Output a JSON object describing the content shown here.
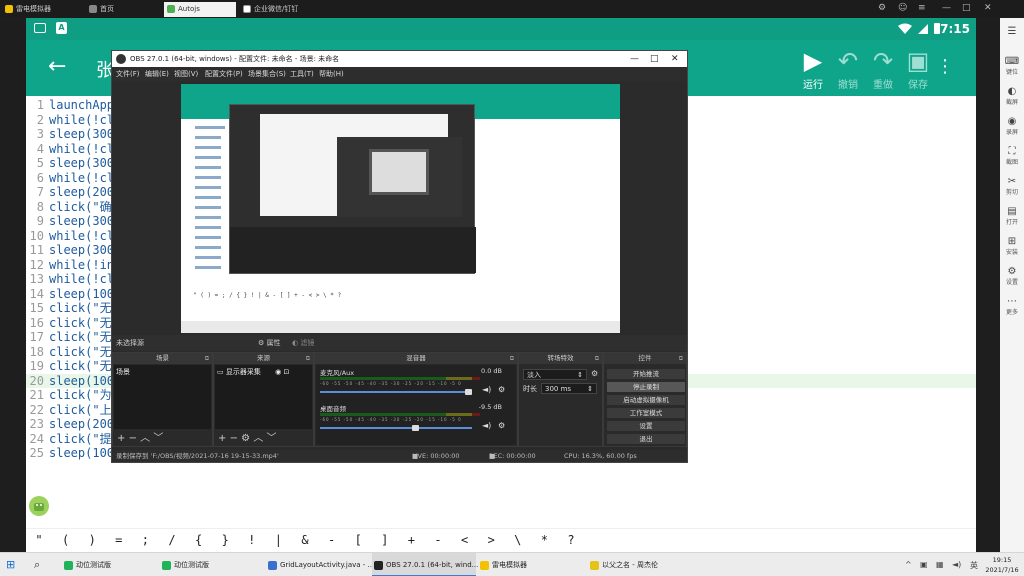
{
  "emulator": {
    "tabs": [
      {
        "label": "雷电模拟器",
        "active": false
      },
      {
        "label": "首页",
        "active": false
      },
      {
        "label": "Autojs",
        "active": true
      },
      {
        "label": "企业微信/钉钉",
        "active": false
      }
    ]
  },
  "statusbar": {
    "time": "7:15",
    "app_badge": "A"
  },
  "appbar": {
    "title": "张",
    "actions": [
      {
        "label": "运行",
        "icon": "play-icon",
        "glyph": "▶"
      },
      {
        "label": "撤销",
        "icon": "undo-icon",
        "glyph": "↶"
      },
      {
        "label": "重做",
        "icon": "redo-icon",
        "glyph": "↷"
      },
      {
        "label": "保存",
        "icon": "save-icon",
        "glyph": "▣"
      }
    ]
  },
  "code": {
    "highlight_line": 20,
    "lines": [
      {
        "n": "1",
        "t": "launchApp"
      },
      {
        "n": "2",
        "t": "while(!cl"
      },
      {
        "n": "3",
        "t": "sleep(300"
      },
      {
        "n": "4",
        "t": "while(!cl"
      },
      {
        "n": "5",
        "t": "sleep(300"
      },
      {
        "n": "6",
        "t": "while(!cl"
      },
      {
        "n": "7",
        "t": "sleep(200"
      },
      {
        "n": "8",
        "t": "click(\"确"
      },
      {
        "n": "9",
        "t": "sleep(300"
      },
      {
        "n": "10",
        "t": "while(!cl"
      },
      {
        "n": "11",
        "t": "sleep(300"
      },
      {
        "n": "12",
        "t": "while(!in"
      },
      {
        "n": "13",
        "t": "while(!cl"
      },
      {
        "n": "14",
        "t": "sleep(100"
      },
      {
        "n": "15",
        "t": "click(\"无"
      },
      {
        "n": "16",
        "t": "click(\"无"
      },
      {
        "n": "17",
        "t": "click(\"无"
      },
      {
        "n": "18",
        "t": "click(\"无"
      },
      {
        "n": "19",
        "t": "click(\"无"
      },
      {
        "n": "20",
        "t": "sleep(100"
      },
      {
        "n": "21",
        "t": "click(\"为"
      },
      {
        "n": "22",
        "t": "click(\"上"
      },
      {
        "n": "23",
        "t": "sleep(200"
      },
      {
        "n": "24",
        "t": "click(\"提"
      },
      {
        "n": "25",
        "t": "sleep(100"
      }
    ]
  },
  "symbols": [
    "\"",
    "(",
    ")",
    "=",
    ";",
    "/",
    "{",
    "}",
    "!",
    "|",
    "&",
    "-",
    "[",
    "]",
    "+",
    "-",
    "<",
    ">",
    "\\",
    "*",
    "?"
  ],
  "right_sidebar": [
    {
      "label": "",
      "glyph": "☰"
    },
    {
      "label": "键位",
      "glyph": "⌨"
    },
    {
      "label": "截屏",
      "glyph": "◐"
    },
    {
      "label": "录屏",
      "glyph": "◉"
    },
    {
      "label": "截图",
      "glyph": "⛶"
    },
    {
      "label": "剪切",
      "glyph": "✂"
    },
    {
      "label": "打开",
      "glyph": "▤"
    },
    {
      "label": "安装",
      "glyph": "⊞"
    },
    {
      "label": "设置",
      "glyph": "⚙"
    },
    {
      "label": "更多",
      "glyph": "⋯"
    }
  ],
  "obs": {
    "title": "OBS 27.0.1 (64-bit, windows) - 配置文件: 未命名 - 场景: 未命名",
    "menu": [
      "文件(F)",
      "编辑(E)",
      "视图(V)",
      "配置文件(P)",
      "场景集合(S)",
      "工具(T)",
      "帮助(H)"
    ],
    "no_source": "未选择源",
    "properties": "属性",
    "filters": "滤镜",
    "docks": {
      "scenes": {
        "title": "场景",
        "items": [
          "场景"
        ]
      },
      "sources": {
        "title": "来源",
        "items": [
          "显示器采集"
        ]
      },
      "mixer": {
        "title": "混音器",
        "channels": [
          {
            "name": "麦克风/Aux",
            "db": "0.0 dB",
            "fader": 0.98
          },
          {
            "name": "桌面音频",
            "db": "-9.5 dB",
            "fader": 0.62
          }
        ],
        "scale": "-60 -55 -50 -45 -40 -35 -30 -25 -20 -15 -10 -5 0"
      },
      "transitions": {
        "title": "转场特效",
        "type": "淡入",
        "duration_label": "时长",
        "duration": "300 ms"
      },
      "controls": {
        "title": "控件",
        "buttons": [
          "开始推流",
          "停止录制",
          "启动虚拟摄像机",
          "工作室模式",
          "设置",
          "退出"
        ],
        "selected": 1
      }
    },
    "status": {
      "recording_path": "录制保存到 'F:/OBS/视频/2021-07-16 19-15-33.mp4'",
      "live": "LIVE: 00:00:00",
      "rec": "REC: 00:00:00",
      "cpu": "CPU: 16.3%, 60.00 fps"
    }
  },
  "taskbar": {
    "apps": [
      {
        "label": "动位测试版",
        "color": "#1fb45a",
        "active": false
      },
      {
        "label": "动位测试版",
        "color": "#1fb45a",
        "active": false
      },
      {
        "label": "GridLayoutActivity.java - ...",
        "color": "#3a6fd0",
        "active": false
      },
      {
        "label": "OBS 27.0.1 (64-bit, wind...",
        "color": "#222222",
        "active": true
      },
      {
        "label": "雷电模拟器",
        "color": "#f2c200",
        "active": false
      },
      {
        "label": "以父之名 - 周杰伦",
        "color": "#e6c317",
        "active": false
      }
    ],
    "time": "19:15",
    "date": "2021/7/16"
  }
}
